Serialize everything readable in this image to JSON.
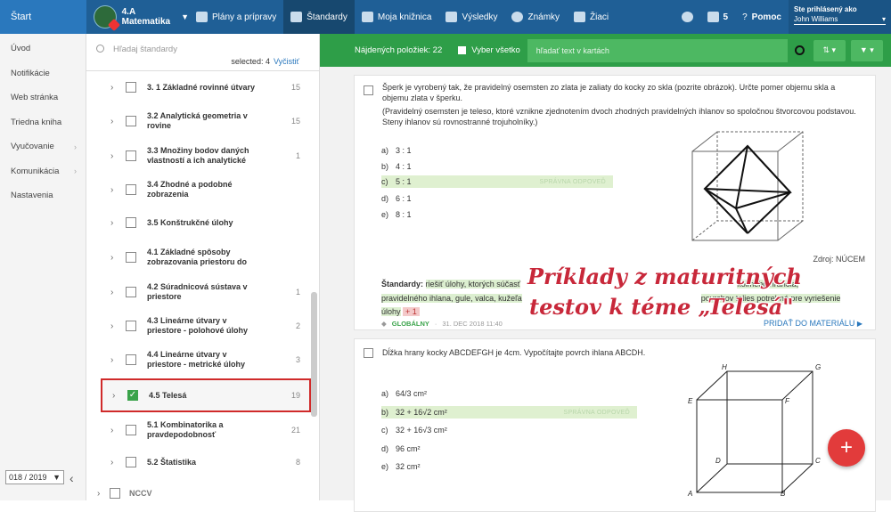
{
  "topbar": {
    "start": "Štart",
    "class_name_1": "4.A",
    "class_name_2": "Matematika",
    "nav": [
      {
        "label": "Plány a prípravy",
        "icon": "briefcase-icon"
      },
      {
        "label": "Štandardy",
        "icon": "shield-icon"
      },
      {
        "label": "Moja knižnica",
        "icon": "library-icon"
      },
      {
        "label": "Výsledky",
        "icon": "chart-icon"
      },
      {
        "label": "Známky",
        "icon": "grade-icon"
      },
      {
        "label": "Žiaci",
        "icon": "students-icon"
      }
    ],
    "mail_count": "5",
    "help": "Pomoc",
    "logged_as": "Ste prihlásený ako",
    "user": "John Williams"
  },
  "leftnav": {
    "items": [
      {
        "label": "Úvod",
        "arrow": false
      },
      {
        "label": "Notifikácie",
        "arrow": false
      },
      {
        "label": "Web stránka",
        "arrow": false
      },
      {
        "label": "Triedna kniha",
        "arrow": false
      },
      {
        "label": "Vyučovanie",
        "arrow": true
      },
      {
        "label": "Komunikácia",
        "arrow": true
      },
      {
        "label": "Nastavenia",
        "arrow": false
      }
    ],
    "year": "018 / 2019"
  },
  "standards": {
    "search_placeholder": "Hľadaj štandardy",
    "selected": "selected: 4",
    "clear": "Vyčistiť",
    "items": [
      {
        "label": "3. 1 Základné rovinné útvary",
        "count": "15",
        "checked": false
      },
      {
        "label": "3.2 Analytická geometria v rovine",
        "count": "15",
        "checked": false
      },
      {
        "label": "3.3 Množiny bodov daných vlastností a ich analytické",
        "count": "1",
        "checked": false
      },
      {
        "label": "3.4 Zhodné a podobné zobrazenia",
        "count": "",
        "checked": false
      },
      {
        "label": "3.5 Konštrukčné úlohy",
        "count": "",
        "checked": false
      },
      {
        "label": "4.1 Základné spôsoby zobrazovania priestoru do",
        "count": "",
        "checked": false
      },
      {
        "label": "4.2 Súradnicová sústava v priestore",
        "count": "1",
        "checked": false
      },
      {
        "label": "4.3 Lineárne útvary v priestore - polohové úlohy",
        "count": "2",
        "checked": false
      },
      {
        "label": "4.4 Lineárne útvary v priestore - metrické úlohy",
        "count": "3",
        "checked": false
      },
      {
        "label": "4.5 Telesá",
        "count": "19",
        "checked": true
      },
      {
        "label": "5.1 Kombinatorika a pravdepodobnosť",
        "count": "21",
        "checked": false
      },
      {
        "label": "5.2 Štatistika",
        "count": "8",
        "checked": false
      }
    ],
    "partial_last": "NCCV"
  },
  "toolbar": {
    "found": "Nájdených položiek: 22",
    "select_all": "Vyber všetko",
    "filter_placeholder": "hľadať text v kartách"
  },
  "card1": {
    "question": "Šperk je vyrobený tak, že pravidelný osemsten zo zlata je zaliaty do kocky zo skla (pozrite obrázok). Určte pomer objemu skla a objemu zlata v šperku.",
    "note": "(Pravidelný osemsten je teleso, ktoré vznikne zjednotením dvoch zhodných pravidelných ihlanov so spoločnou štvorcovou podstavou. Steny ihlanov sú rovnostranné trojuholníky.)",
    "options": [
      {
        "letter": "a)",
        "text": "3 : 1",
        "correct": false
      },
      {
        "letter": "b)",
        "text": "4 : 1",
        "correct": false
      },
      {
        "letter": "c)",
        "text": "5 : 1",
        "correct": true
      },
      {
        "letter": "d)",
        "text": "6 : 1",
        "correct": false
      },
      {
        "letter": "e)",
        "text": "8 : 1",
        "correct": false
      }
    ],
    "correct_label": "SPRÁVNA ODPOVEĎ",
    "source": "Zdroj: NÚCEM",
    "standards_label": "Štandardy:",
    "standards_text_a": "riešiť úlohy, ktorých súčasť",
    "standards_text_b": "kolmého hranola,",
    "standards_text_c": "pravidelného ihlana, gule, valca, kužeľa",
    "standards_text_d": "povrchov telies potrebné pre vyriešenie úlohy",
    "plus": "+ 1",
    "global": "GLOBÁLNY",
    "date": "31. DEC 2018 11:40",
    "add": "PRIDAŤ DO MATERIÁLU"
  },
  "card2": {
    "question": "Dĺžka hrany kocky ABCDEFGH je 4cm. Vypočítajte povrch ihlana ABCDH.",
    "options": [
      {
        "letter": "a)",
        "text": "64/3 cm²",
        "correct": false
      },
      {
        "letter": "b)",
        "text": "32 + 16√2 cm²",
        "correct": true
      },
      {
        "letter": "c)",
        "text": "32 + 16√3 cm²",
        "correct": false
      },
      {
        "letter": "d)",
        "text": "96 cm²",
        "correct": false
      },
      {
        "letter": "e)",
        "text": "32 cm²",
        "correct": false
      }
    ],
    "correct_label": "SPRÁVNA ODPOVEĎ",
    "cube_labels": [
      "H",
      "G",
      "E",
      "F",
      "D",
      "C",
      "A",
      "B"
    ]
  },
  "overlay": {
    "line1": "Príklady z maturitných",
    "line2": "testov k téme „Telesá\""
  }
}
